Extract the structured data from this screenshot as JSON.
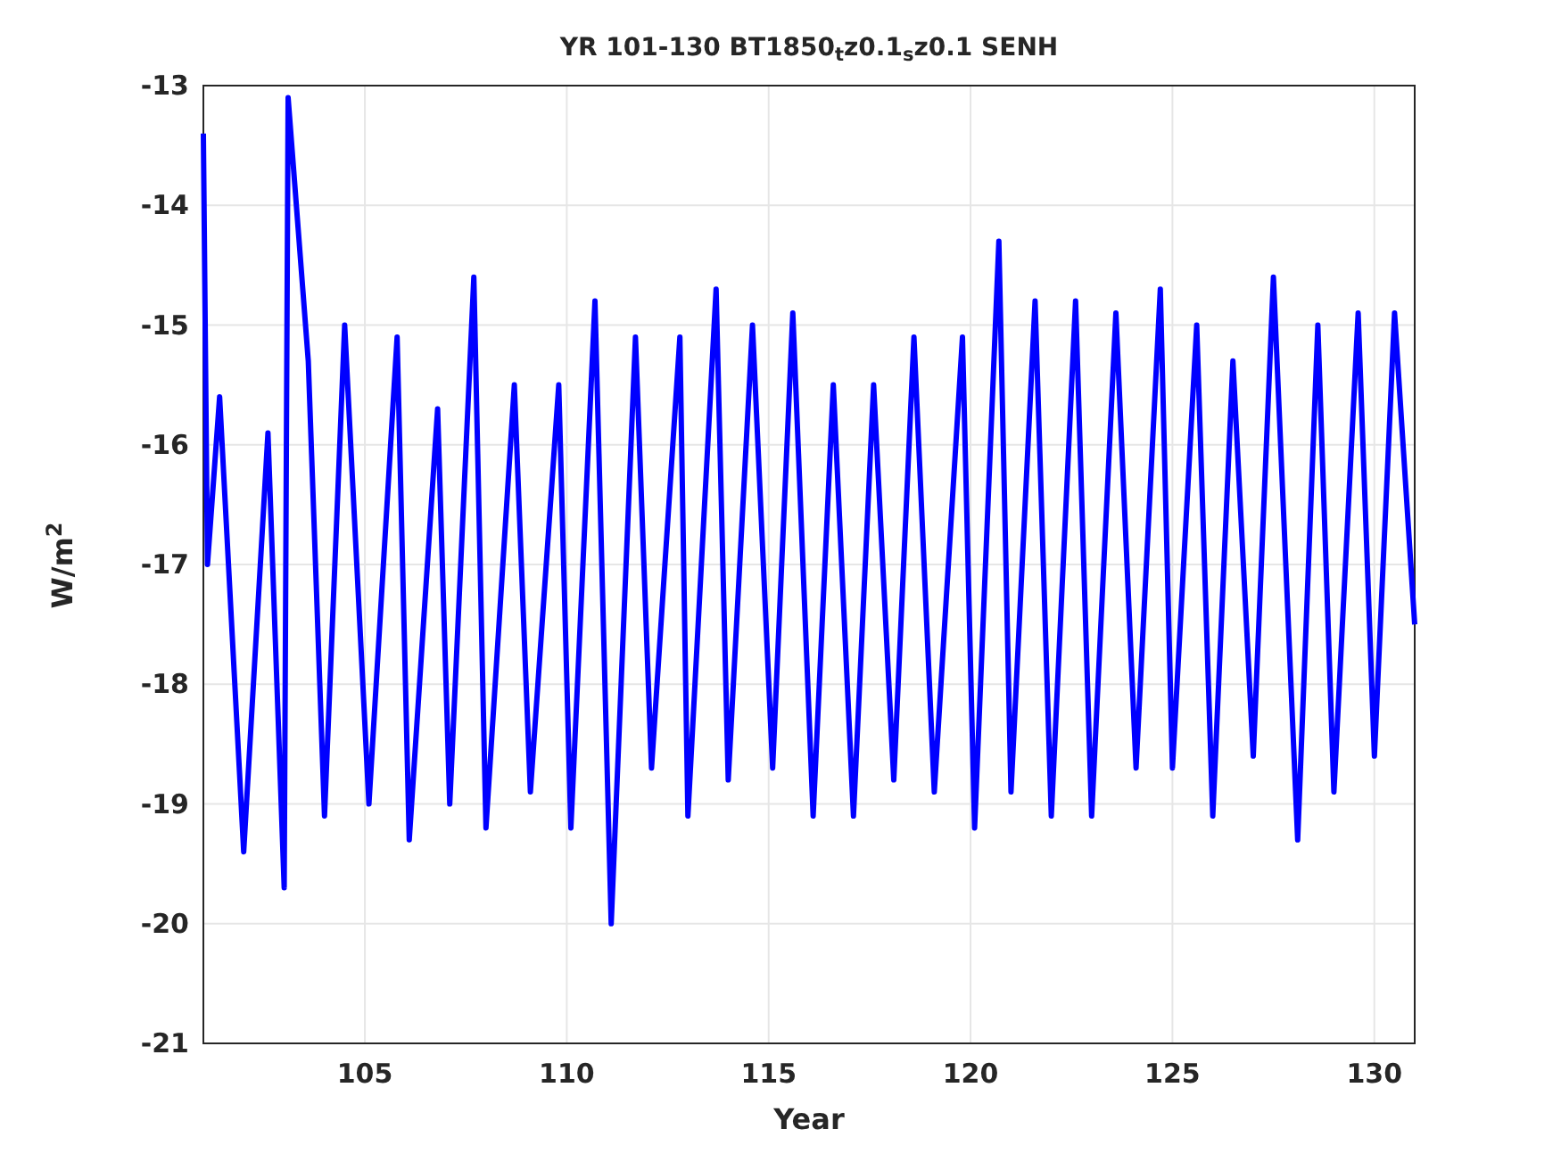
{
  "title": "YR 101-130 BT1850$_{t}$z0.1$_{s}$z0.1 SENH",
  "chart_data": {
    "type": "line",
    "grid": true,
    "xlabel": "Year",
    "ylabel": "W/m$^{2}$",
    "xlim": [
      101,
      131
    ],
    "ylim": [
      -21,
      -13
    ],
    "xticks": [
      105,
      110,
      115,
      120,
      125,
      130
    ],
    "yticks": [
      -21,
      -20,
      -19,
      -18,
      -17,
      -16,
      -15,
      -14,
      -13
    ],
    "x": [
      101.0,
      101.1,
      101.4,
      102.0,
      102.6,
      103.0,
      103.1,
      103.6,
      104.0,
      104.5,
      105.1,
      105.8,
      106.1,
      106.8,
      107.1,
      107.7,
      108.0,
      108.7,
      109.1,
      109.8,
      110.1,
      110.7,
      111.1,
      111.7,
      112.1,
      112.8,
      113.0,
      113.7,
      114.0,
      114.6,
      115.1,
      115.6,
      116.1,
      116.6,
      117.1,
      117.6,
      118.1,
      118.6,
      119.1,
      119.8,
      120.1,
      120.7,
      121.0,
      121.6,
      122.0,
      122.6,
      123.0,
      123.6,
      124.1,
      124.7,
      125.0,
      125.6,
      126.0,
      126.5,
      127.0,
      127.5,
      128.1,
      128.6,
      129.0,
      129.6,
      130.0,
      130.5,
      131.0
    ],
    "series": [
      {
        "color": "#0000ff",
        "values": [
          -13.4,
          -17.0,
          -15.6,
          -19.4,
          -15.9,
          -19.7,
          -13.1,
          -15.3,
          -19.1,
          -15.0,
          -19.0,
          -15.1,
          -19.3,
          -15.7,
          -19.0,
          -14.6,
          -19.2,
          -15.5,
          -18.9,
          -15.5,
          -19.2,
          -14.8,
          -20.0,
          -15.1,
          -18.7,
          -15.1,
          -19.1,
          -14.7,
          -18.8,
          -15.0,
          -18.7,
          -14.9,
          -19.1,
          -15.5,
          -19.1,
          -15.5,
          -18.8,
          -15.1,
          -18.9,
          -15.1,
          -19.2,
          -14.3,
          -18.9,
          -14.8,
          -19.1,
          -14.8,
          -19.1,
          -14.9,
          -18.7,
          -14.7,
          -18.7,
          -15.0,
          -19.1,
          -15.3,
          -18.6,
          -14.6,
          -19.3,
          -15.0,
          -18.9,
          -14.9,
          -18.6,
          -14.9,
          -17.5
        ]
      }
    ]
  }
}
